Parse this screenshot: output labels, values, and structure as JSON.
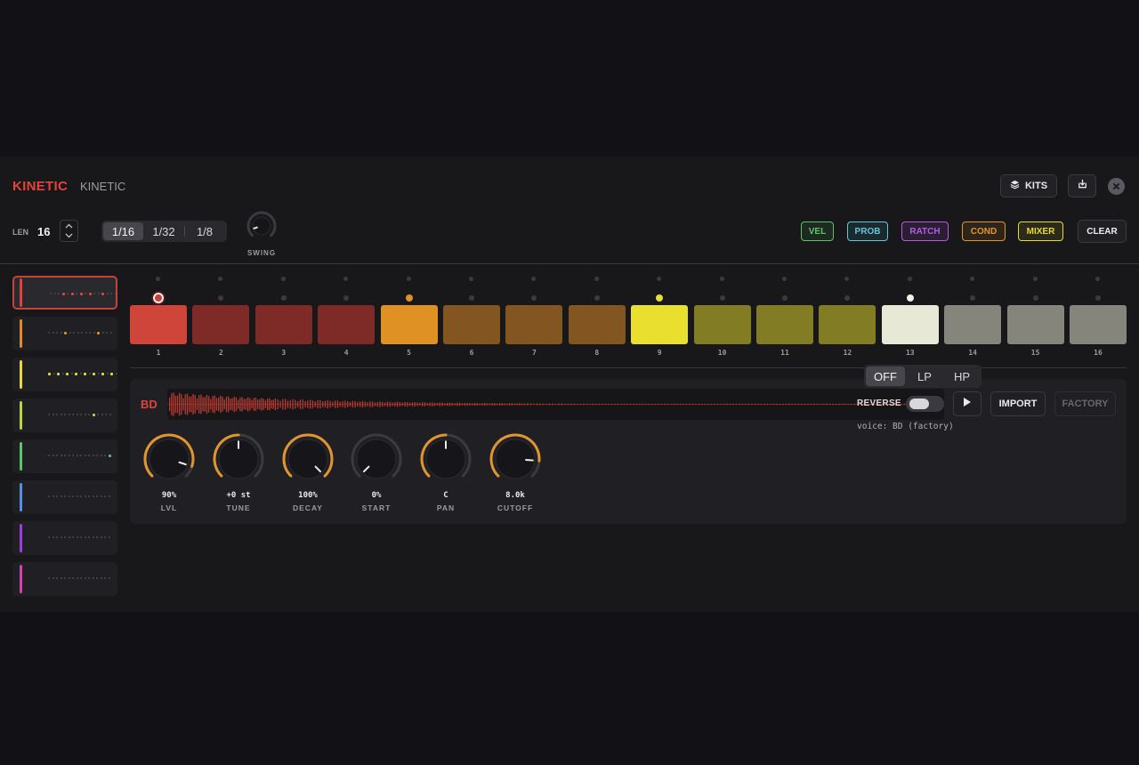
{
  "header": {
    "brand": "KINETIC",
    "title": "KINETIC",
    "kits_label": "KITS",
    "icons": [
      "layers-icon",
      "export-icon",
      "close-icon"
    ]
  },
  "toolbar": {
    "len_label": "LEN",
    "len_value": "16",
    "resolutions": [
      "1/16",
      "1/32",
      "1/8"
    ],
    "active_resolution": "1/16",
    "swing_label": "SWING",
    "swing_amount": 0.1,
    "tags": [
      {
        "label": "VEL",
        "color": "#5ec46a",
        "bg": "#1e2a20"
      },
      {
        "label": "PROB",
        "color": "#62c6d8",
        "bg": "#1c2a2e"
      },
      {
        "label": "RATCH",
        "color": "#b65be6",
        "bg": "#2a1e32"
      },
      {
        "label": "COND",
        "color": "#e0952f",
        "bg": "#2e241a"
      },
      {
        "label": "MIXER",
        "color": "#e8d83a",
        "bg": "#2c2a18"
      }
    ],
    "clear_label": "CLEAR"
  },
  "tracks": [
    {
      "color": "#e0433a",
      "on": [
        3,
        5,
        7,
        9,
        12
      ],
      "selected": true
    },
    {
      "color": "#e08a2a",
      "on": [
        4,
        12
      ],
      "selected": false
    },
    {
      "color": "#e8d83a",
      "on": [
        0,
        2,
        4,
        6,
        8,
        10,
        12,
        14
      ],
      "selected": false,
      "all_lit": true
    },
    {
      "color": "#b7d640",
      "on": [
        11
      ],
      "selected": false
    },
    {
      "color": "#5ec46a",
      "on": [
        15
      ],
      "selected": false
    },
    {
      "color": "#5a8fe0",
      "on": [],
      "selected": false
    },
    {
      "color": "#9a3fe0",
      "on": [],
      "selected": false
    },
    {
      "color": "#d63fb0",
      "on": [],
      "selected": false
    }
  ],
  "steps": [
    {
      "number": "1",
      "color": "#d0453a",
      "dot": "ring"
    },
    {
      "number": "2",
      "color": "#7e2a27",
      "dot": "off"
    },
    {
      "number": "3",
      "color": "#7e2a27",
      "dot": "off"
    },
    {
      "number": "4",
      "color": "#7e2a27",
      "dot": "off"
    },
    {
      "number": "5",
      "color": "#df9223",
      "dot": "#df9223"
    },
    {
      "number": "6",
      "color": "#835520",
      "dot": "off"
    },
    {
      "number": "7",
      "color": "#835520",
      "dot": "off"
    },
    {
      "number": "8",
      "color": "#835520",
      "dot": "off"
    },
    {
      "number": "9",
      "color": "#e8df2e",
      "dot": "#e8df2e"
    },
    {
      "number": "10",
      "color": "#827c24",
      "dot": "off"
    },
    {
      "number": "11",
      "color": "#827c24",
      "dot": "off"
    },
    {
      "number": "12",
      "color": "#827c24",
      "dot": "off"
    },
    {
      "number": "13",
      "color": "#e8e8d6",
      "dot": "#f0f0e6"
    },
    {
      "number": "14",
      "color": "#85857c",
      "dot": "off"
    },
    {
      "number": "15",
      "color": "#85857c",
      "dot": "off"
    },
    {
      "number": "16",
      "color": "#85857c",
      "dot": "off"
    }
  ],
  "voice": {
    "name": "BD",
    "import_label": "IMPORT",
    "factory_label": "FACTORY",
    "knobs": [
      {
        "value": "90%",
        "label": "LVL",
        "amount": 0.9
      },
      {
        "value": "+0 st",
        "label": "TUNE",
        "amount": 0.5
      },
      {
        "value": "100%",
        "label": "DECAY",
        "amount": 1.0
      },
      {
        "value": "0%",
        "label": "START",
        "amount": 0.0
      },
      {
        "value": "C",
        "label": "PAN",
        "amount": 0.5
      },
      {
        "value": "8.0k",
        "label": "CUTOFF",
        "amount": 0.85
      }
    ],
    "filters": [
      "OFF",
      "LP",
      "HP"
    ],
    "active_filter": "OFF",
    "reverse_label": "REVERSE",
    "reverse_on": false,
    "info": "voice: BD (factory)"
  },
  "colors": {
    "accent": "#e2443a",
    "knob_arc": "#e0952f",
    "waveform": "#b83a32"
  }
}
